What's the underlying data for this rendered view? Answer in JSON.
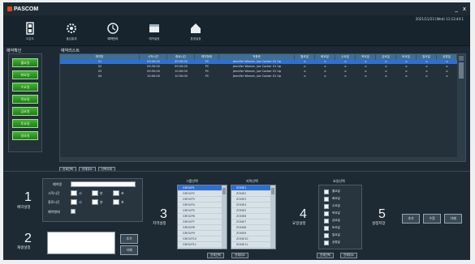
{
  "app": {
    "logo": "PASCOM",
    "datetime": "2021/11/23 (Wed) 11:13:44:1"
  },
  "window": {
    "minimize": "_",
    "close": "x"
  },
  "toolbar": [
    {
      "label": "오픈도",
      "icon": "door-icon"
    },
    {
      "label": "출입통제",
      "icon": "gear-icon"
    },
    {
      "label": "예약관리",
      "icon": "clock-icon"
    },
    {
      "label": "예약설정",
      "icon": "calendar-icon"
    },
    {
      "label": "환경설정",
      "icon": "house-icon"
    }
  ],
  "left_panel": {
    "title": "예약확인",
    "days": [
      "월요일",
      "화요일",
      "수요일",
      "목요일",
      "금요일",
      "토요일",
      "일요일"
    ]
  },
  "reservation_list": {
    "title": "예약리스트",
    "columns": [
      "예약명",
      "시작시간",
      "종료시간",
      "예약형태",
      "적용층",
      "월요일",
      "화요일",
      "수요일",
      "목요일",
      "금요일",
      "토요일",
      "일요일",
      "공휴일"
    ],
    "rows": [
      [
        "01",
        "09:00:00",
        "09:30:00",
        "PC",
        "Jennifer Warner, Joe Cocker 01 Up",
        "o",
        "o",
        "o",
        "o",
        "o",
        "o",
        "o",
        "o"
      ],
      [
        "02",
        "09:30:00",
        "09:50:00",
        "PC",
        "Jennifer Warner, Joe Cocker 01 Up",
        "o",
        "o",
        "o",
        "o",
        "o",
        "o",
        "o",
        "o"
      ],
      [
        "03",
        "09:50:00",
        "10:00:00",
        "PC",
        "Jennifer Warner, Joe Cocker 01 Up",
        "o",
        "o",
        "o",
        "o",
        "o",
        "o",
        "o",
        "o"
      ],
      [
        "04",
        "10:00:00",
        "10:30:00",
        "PC",
        "Jennifer Warner, Joe Cocker 01 Up",
        "o",
        "o",
        "o",
        "o",
        "o",
        "o",
        "o",
        "o"
      ]
    ],
    "buttons": [
      "전체선택",
      "전체취소",
      "선택삭제"
    ]
  },
  "section1": {
    "number": "1",
    "label": "예약설정",
    "name_label": "예약명",
    "start_label": "시작시간",
    "end_label": "종료시간",
    "hour": "시",
    "min": "분",
    "sec": "초",
    "type_label": "예약형태"
  },
  "section2": {
    "number": "2",
    "label": "재생설정",
    "btn1": "추가",
    "btn2": "삭제"
  },
  "section3": {
    "number": "3",
    "label": "지역설정",
    "group_title": "그룹선택",
    "zone_title": "지역선택",
    "groups": [
      "GROUP1",
      "GROUP2",
      "GROUP3",
      "GROUP4",
      "GROUP5",
      "GROUP6",
      "GROUP7",
      "GROUP8",
      "GROUP9",
      "GROUP10",
      "GROUP11"
    ],
    "zones": [
      "ZONE1",
      "ZONE2",
      "ZONE3",
      "ZONE4",
      "ZONE5",
      "ZONE6",
      "ZONE7",
      "ZONE8",
      "ZONE9",
      "ZONE10",
      "ZONE11"
    ],
    "buttons": [
      "전체선택",
      "전체취소"
    ]
  },
  "section4": {
    "number": "4",
    "label": "요일설정",
    "title": "요일선택",
    "days": [
      "월요일",
      "화요일",
      "수요일",
      "목요일",
      "금요일",
      "토요일",
      "일요일",
      "공휴일"
    ],
    "buttons": [
      "전체선택",
      "전체취소"
    ]
  },
  "section5": {
    "number": "5",
    "label": "설정저장",
    "buttons": [
      "추가",
      "수정",
      "삭제"
    ]
  }
}
